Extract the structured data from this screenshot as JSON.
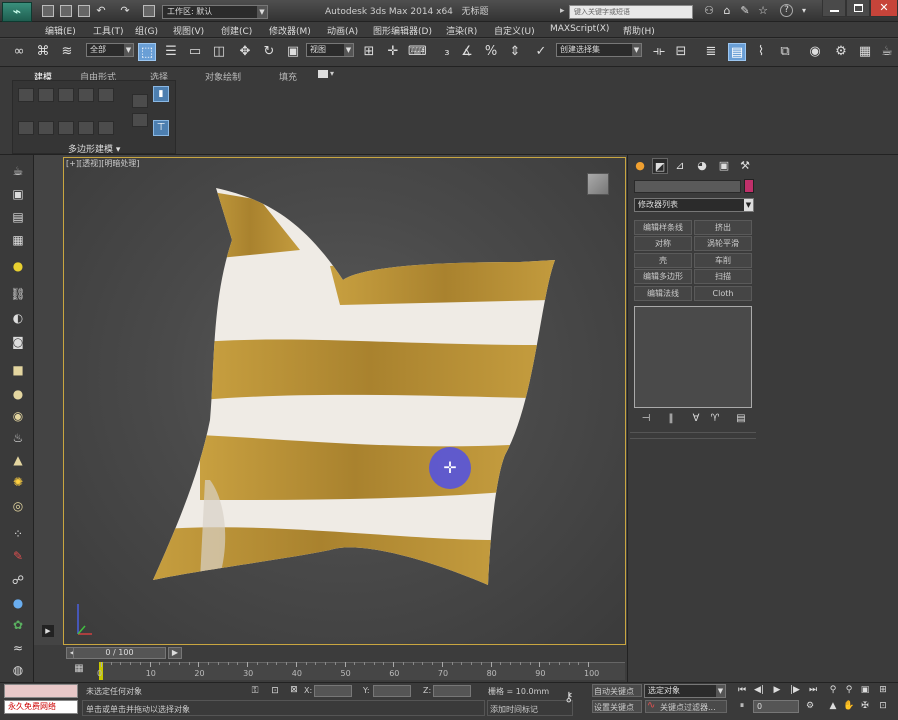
{
  "titlebar": {
    "workspace_label": "工作区: 默认",
    "app_title": "Autodesk 3ds Max  2014 x64",
    "doc_name": "无标题",
    "search_placeholder": "键入关键字或短语"
  },
  "menu": [
    "编辑(E)",
    "工具(T)",
    "组(G)",
    "视图(V)",
    "创建(C)",
    "修改器(M)",
    "动画(A)",
    "图形编辑器(D)",
    "渲染(R)",
    "自定义(U)",
    "MAXScript(X)",
    "帮助(H)"
  ],
  "maintoolbar": {
    "selection_filter": "全部",
    "reference_coord": "视图",
    "named_selection": "创建选择集"
  },
  "ribbon": {
    "tabs": [
      "建模",
      "自由形式",
      "选择",
      "对象绘制",
      "填充"
    ],
    "group_label": "多边形建模"
  },
  "viewport": {
    "label_plus": "[+]",
    "label_view": "[透视]",
    "label_shading": "[明暗处理]"
  },
  "command_panel": {
    "modifier_list": "修改器列表",
    "modifier_buttons": [
      "编辑样条线",
      "挤出",
      "对称",
      "涡轮平滑",
      "壳",
      "车削",
      "编辑多边形",
      "扫描",
      "编辑法线",
      "Cloth"
    ]
  },
  "timeline": {
    "frame_display": "0 / 100",
    "ticks": [
      "0",
      "10",
      "20",
      "30",
      "40",
      "50",
      "60",
      "70",
      "80",
      "90",
      "100"
    ]
  },
  "status": {
    "user_status": "永久免费网络",
    "selection_status": "未选定任何对象",
    "prompt_text": "单击或单击并拖动以选择对象",
    "x_label": "X:",
    "y_label": "Y:",
    "z_label": "Z:",
    "grid_text": "栅格 = 10.0mm",
    "add_time_tag": "添加时间标记",
    "auto_key": "自动关键点",
    "set_key": "设置关键点",
    "selected_object": "选定对象",
    "key_filters": "关键点过滤器...",
    "frame_field": "0"
  },
  "colors": {
    "accent_blue": "#6a9fd6",
    "viewport_border": "#c9a640",
    "object_color_swatch": "#c0306a",
    "cursor_circle": "#5050e6",
    "pillow_gold": "#b8902c",
    "pillow_white": "#efebe5"
  }
}
